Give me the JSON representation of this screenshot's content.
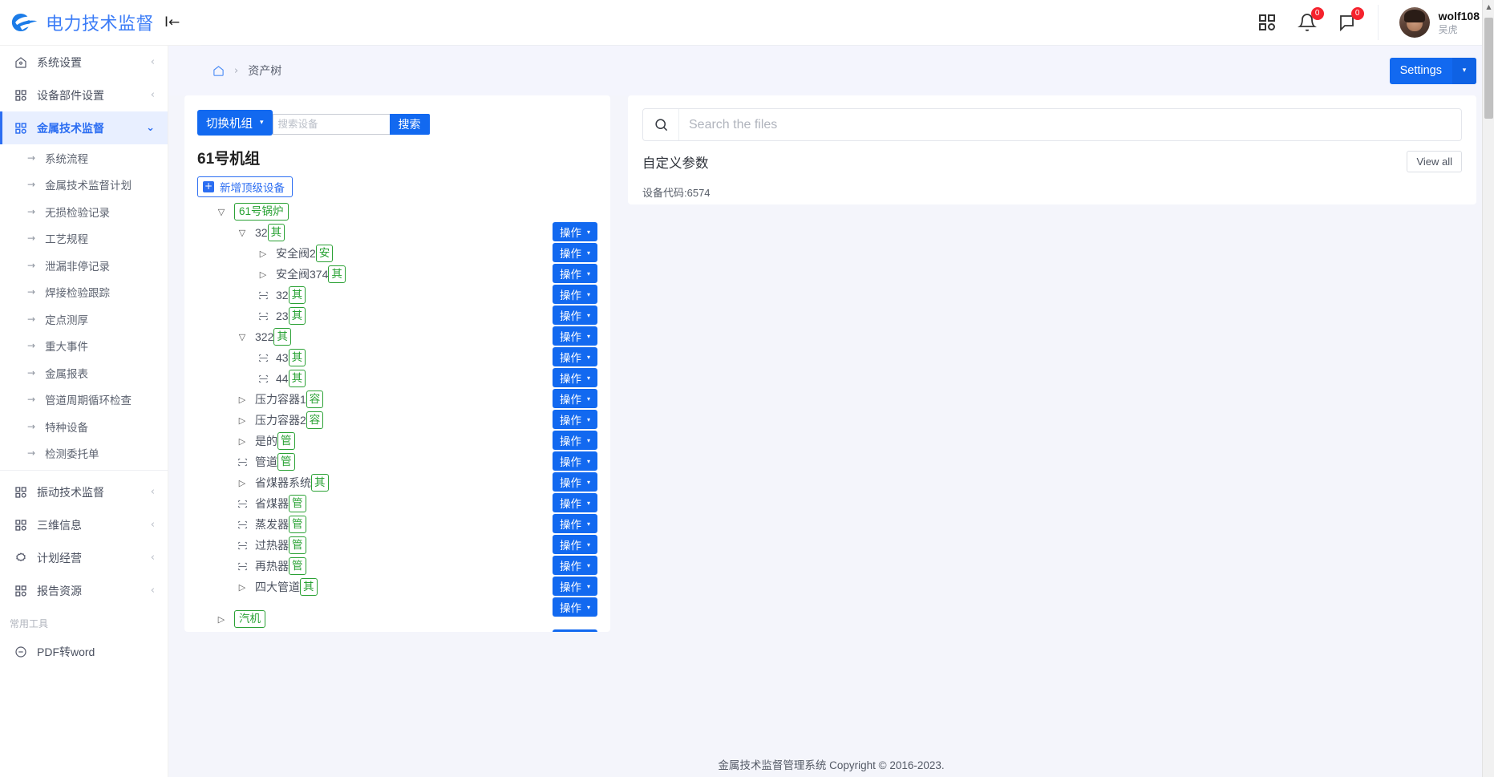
{
  "brand": {
    "title": "电力技术监督",
    "collapse_icon": "collapse-left-icon"
  },
  "header": {
    "apps_icon": "apps-grid-icon",
    "bell_badge": "0",
    "message_badge": "0",
    "user_name": "wolf108",
    "user_realname": "吴虎"
  },
  "sidebar": {
    "items": [
      {
        "label": "系统设置",
        "icon": "home-icon",
        "chevron": "‹",
        "active": false
      },
      {
        "label": "设备部件设置",
        "icon": "grid-icon",
        "chevron": "‹",
        "active": false
      },
      {
        "label": "金属技术监督",
        "icon": "grid-icon",
        "chevron": "⌄",
        "active": true
      }
    ],
    "submenu": [
      "系统流程",
      "金属技术监督计划",
      "无损检验记录",
      "工艺规程",
      "泄漏非停记录",
      "焊接检验跟踪",
      "定点测厚",
      "重大事件",
      "金属报表",
      "管道周期循环检查",
      "特种设备",
      "检测委托单"
    ],
    "items_after": [
      {
        "label": "振动技术监督",
        "icon": "grid-icon",
        "chevron": "‹"
      },
      {
        "label": "三维信息",
        "icon": "grid-icon",
        "chevron": "‹"
      },
      {
        "label": "计划经营",
        "icon": "gear-icon",
        "chevron": "‹"
      },
      {
        "label": "报告资源",
        "icon": "grid-icon",
        "chevron": "‹"
      }
    ],
    "tools_header": "常用工具",
    "tools": [
      {
        "label": "PDF转word",
        "icon": "pdf-icon"
      }
    ]
  },
  "breadcrumb": {
    "home_icon": "home-icon",
    "separator": "›",
    "current": "资产树"
  },
  "settings_button": {
    "label": "Settings",
    "caret": "▾"
  },
  "tree_panel": {
    "switch_group_label": "切换机组",
    "switch_group_caret": "▾",
    "search_placeholder": "搜索设备",
    "search_value": "",
    "search_button": "搜索",
    "unit_title": "61号机组",
    "add_top_label": "新增顶级设备",
    "add_top_plus": "+",
    "op_label": "操作",
    "op_caret": "▾",
    "nodes": [
      {
        "indent": 0,
        "caret": "▽",
        "label": "61号锅炉",
        "tag": "",
        "boxed": true
      },
      {
        "indent": 1,
        "caret": "▽",
        "label": "32",
        "tag": "其",
        "boxed": false
      },
      {
        "indent": 2,
        "caret": "▷",
        "label": "安全阀2",
        "tag": "安",
        "boxed": false
      },
      {
        "indent": 2,
        "caret": "▷",
        "label": "安全阀374",
        "tag": "其",
        "boxed": false
      },
      {
        "indent": 2,
        "caret": "leaf",
        "label": "32",
        "tag": "其",
        "boxed": false
      },
      {
        "indent": 2,
        "caret": "leaf",
        "label": "23",
        "tag": "其",
        "boxed": false
      },
      {
        "indent": 1,
        "caret": "▽",
        "label": "322",
        "tag": "其",
        "boxed": false
      },
      {
        "indent": 2,
        "caret": "leaf",
        "label": "43",
        "tag": "其",
        "boxed": false
      },
      {
        "indent": 2,
        "caret": "leaf",
        "label": "44",
        "tag": "其",
        "boxed": false
      },
      {
        "indent": 1,
        "caret": "▷",
        "label": "压力容器1",
        "tag": "容",
        "boxed": false
      },
      {
        "indent": 1,
        "caret": "▷",
        "label": "压力容器2",
        "tag": "容",
        "boxed": false
      },
      {
        "indent": 1,
        "caret": "▷",
        "label": "是的",
        "tag": "管",
        "boxed": false
      },
      {
        "indent": 1,
        "caret": "leaf",
        "label": "管道",
        "tag": "管",
        "boxed": false
      },
      {
        "indent": 1,
        "caret": "▷",
        "label": "省煤器系统",
        "tag": "其",
        "boxed": false
      },
      {
        "indent": 1,
        "caret": "leaf",
        "label": "省煤器",
        "tag": "管",
        "boxed": false
      },
      {
        "indent": 1,
        "caret": "leaf",
        "label": "蒸发器",
        "tag": "管",
        "boxed": false
      },
      {
        "indent": 1,
        "caret": "leaf",
        "label": "过热器",
        "tag": "管",
        "boxed": false
      },
      {
        "indent": 1,
        "caret": "leaf",
        "label": "再热器",
        "tag": "管",
        "boxed": false
      },
      {
        "indent": 1,
        "caret": "▷",
        "label": "四大管道",
        "tag": "其",
        "boxed": false
      },
      {
        "indent": 0,
        "caret": "▷",
        "label": "汽机",
        "tag": "",
        "boxed": true,
        "gap": true
      }
    ]
  },
  "files_panel": {
    "search_icon": "search-icon",
    "search_placeholder": "Search the files",
    "search_value": "",
    "param_title": "自定义参数",
    "view_all": "View all",
    "param_code": "设备代码:6574"
  },
  "footer": {
    "text": "金属技术监督管理系统 Copyright © 2016-2023."
  },
  "colors": {
    "primary": "#1269f0",
    "tag_green": "#27a132",
    "badge_red": "#f5222d",
    "active_bg": "#e8efff"
  }
}
